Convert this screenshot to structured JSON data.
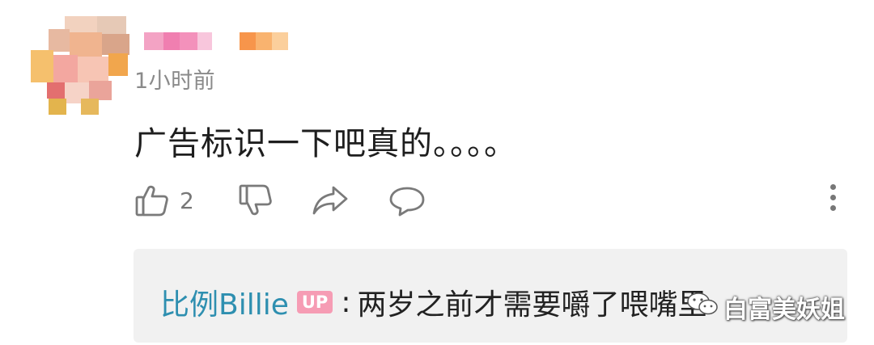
{
  "comment": {
    "time": "1小时前",
    "text": "广告标识一下吧真的。。。。",
    "like_count": "2"
  },
  "reply": {
    "author": "比例Billie",
    "badge": "UP",
    "separator": ":",
    "text": "两岁之前才需要嚼了喂嘴里"
  },
  "watermark": {
    "text": "白富美妖姐",
    "icon": "wechat-icon"
  },
  "icons": {
    "like": "thumbs-up-icon",
    "dislike": "thumbs-down-icon",
    "share": "share-icon",
    "reply": "comment-bubble-icon",
    "more": "more-vertical-icon"
  },
  "colors": {
    "reply_author": "#2e8fb0",
    "up_badge": "#f69cb4",
    "reply_bg": "#f1f1f1",
    "meta_gray": "#8a8a8a"
  }
}
